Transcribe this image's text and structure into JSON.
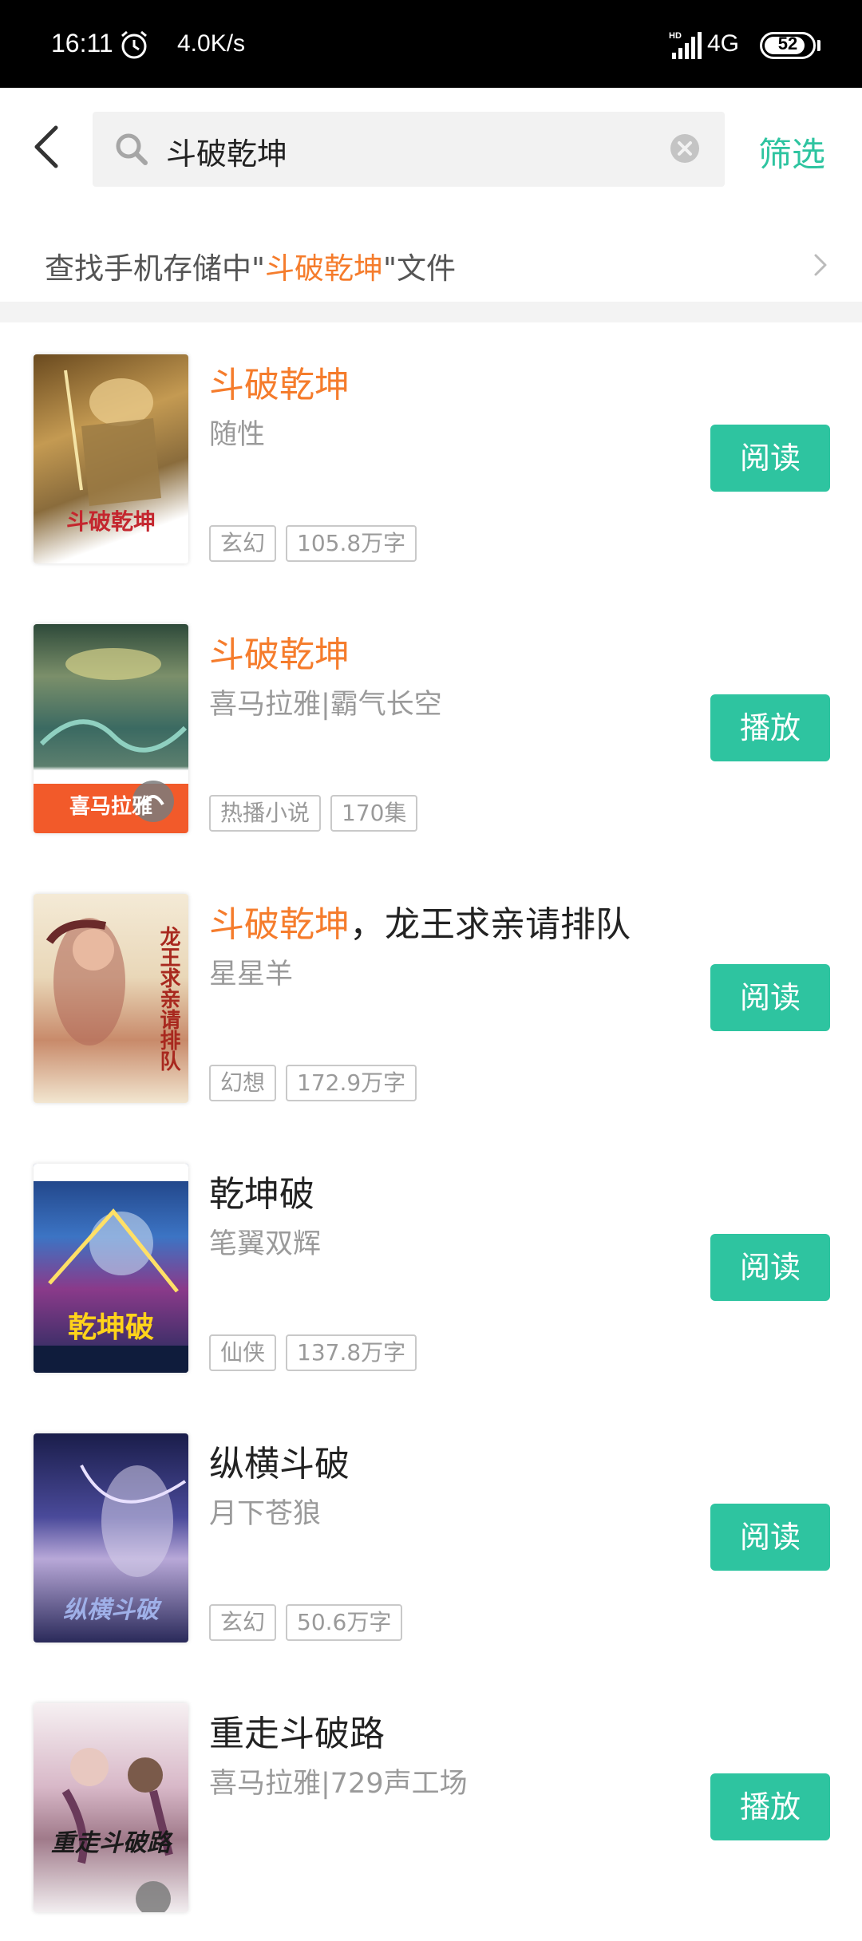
{
  "status_bar": {
    "time": "16:11",
    "speed": "4.0K/s",
    "network": "4G",
    "battery": "52"
  },
  "header": {
    "search_value": "斗破乾坤",
    "filter_label": "筛选"
  },
  "local_search": {
    "prefix": "查找手机存储中\"",
    "keyword": "斗破乾坤",
    "suffix": "\"文件"
  },
  "colors": {
    "accent": "#2ec4a0",
    "highlight": "#f57c2c"
  },
  "results": [
    {
      "title_hl": "斗破乾坤",
      "title_rest": "",
      "author": "随性",
      "tags": [
        "玄幻",
        "105.8万字"
      ],
      "action": "阅读",
      "cover_text": "斗破乾坤"
    },
    {
      "title_hl": "斗破乾坤",
      "title_rest": "",
      "author": "喜马拉雅|霸气长空",
      "tags": [
        "热播小说",
        "170集"
      ],
      "action": "播放",
      "cover_text": "喜马拉雅"
    },
    {
      "title_hl": "斗破乾坤",
      "title_rest": "，龙王求亲请排队",
      "author": "星星羊",
      "tags": [
        "幻想",
        "172.9万字"
      ],
      "action": "阅读",
      "cover_text": "龙王求亲请排队"
    },
    {
      "title_hl": "",
      "title_rest": "乾坤破",
      "author": "笔翼双辉",
      "tags": [
        "仙侠",
        "137.8万字"
      ],
      "action": "阅读",
      "cover_text": "乾坤破"
    },
    {
      "title_hl": "",
      "title_rest": "纵横斗破",
      "author": "月下苍狼",
      "tags": [
        "玄幻",
        "50.6万字"
      ],
      "action": "阅读",
      "cover_text": "纵横斗破"
    },
    {
      "title_hl": "",
      "title_rest": "重走斗破路",
      "author": "喜马拉雅|729声工场",
      "tags": [],
      "action": "播放",
      "cover_text": "重走斗破路"
    }
  ]
}
